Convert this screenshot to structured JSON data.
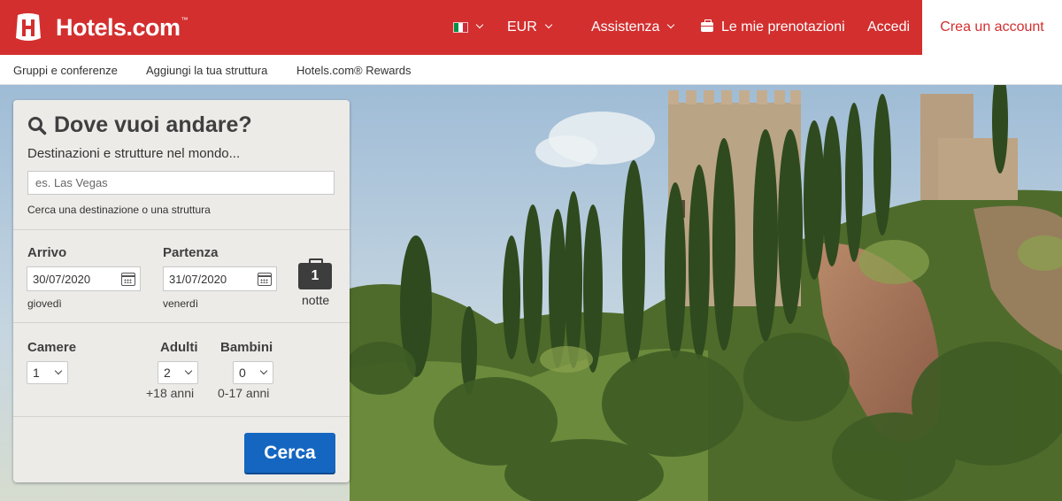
{
  "header": {
    "brand": "Hotels.com",
    "brand_tm": "™",
    "currency": "EUR",
    "help": "Assistenza",
    "bookings": "Le mie prenotazioni",
    "login": "Accedi",
    "create_account": "Crea un account",
    "flag_colors": [
      "#009246",
      "#ffffff",
      "#ce2b37"
    ],
    "brand_color": "#d32f2f"
  },
  "subnav": {
    "items": [
      "Gruppi e conferenze",
      "Aggiungi la tua struttura",
      "Hotels.com® Rewards"
    ]
  },
  "search": {
    "title": "Dove vuoi andare?",
    "destination_label": "Destinazioni e strutture nel mondo...",
    "destination_value": "",
    "destination_placeholder": "es. Las Vegas",
    "destination_help": "Cerca una destinazione o una struttura",
    "checkin_label": "Arrivo",
    "checkin_value": "30/07/2020",
    "checkin_day": "giovedì",
    "checkout_label": "Partenza",
    "checkout_value": "31/07/2020",
    "checkout_day": "venerdì",
    "nights_count": "1",
    "nights_label": "notte",
    "rooms_label": "Camere",
    "rooms_value": "1",
    "adults_label": "Adulti",
    "adults_value": "2",
    "adults_age": "+18 anni",
    "children_label": "Bambini",
    "children_value": "0",
    "children_age": "0-17 anni",
    "search_button": "Cerca",
    "button_color": "#1566c0"
  }
}
